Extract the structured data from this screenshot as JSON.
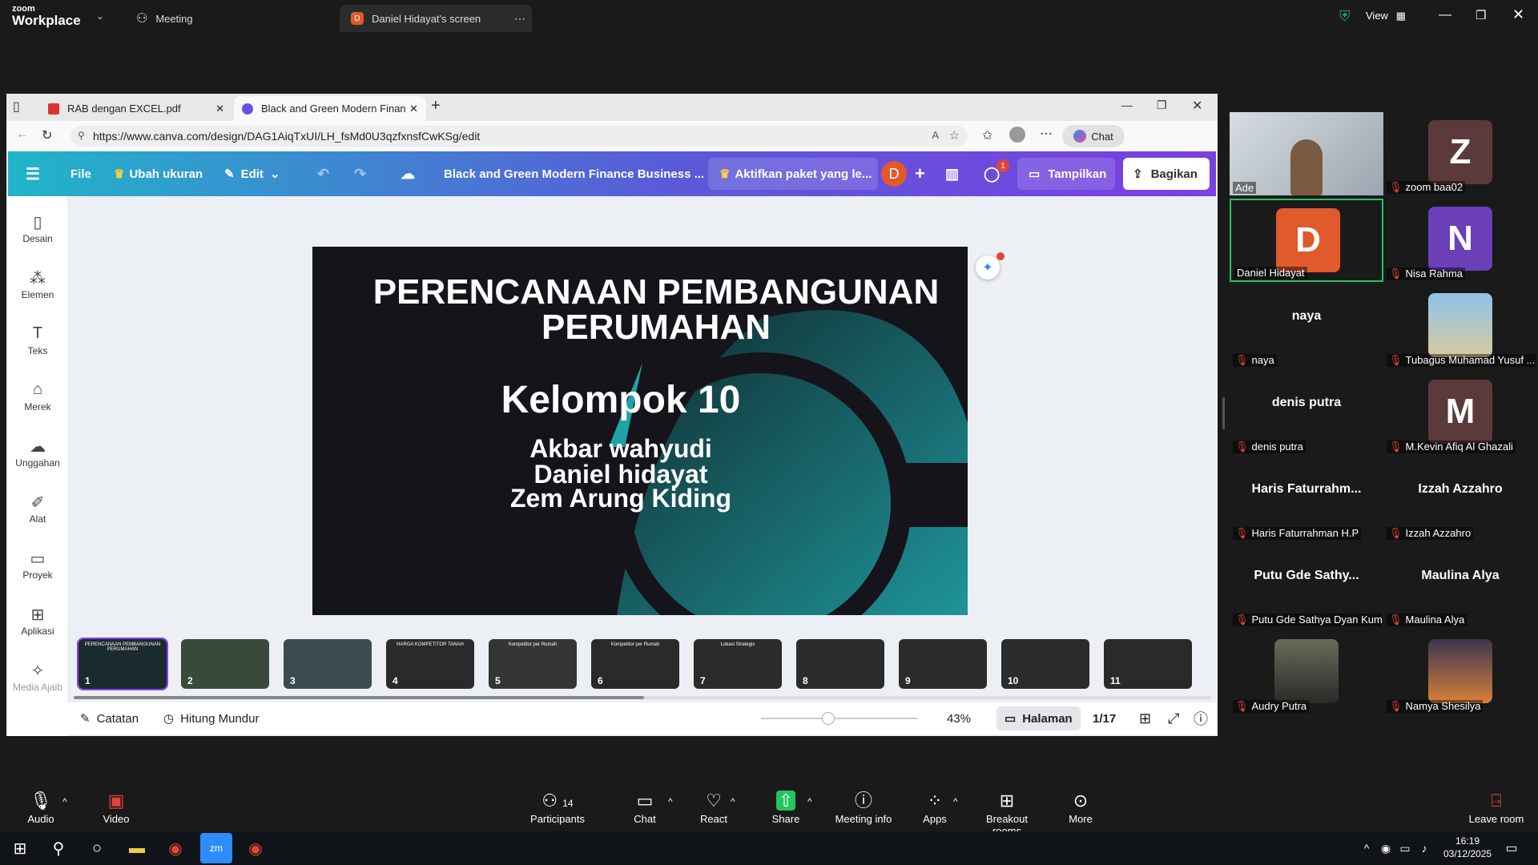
{
  "zoom_top": {
    "brand_line1": "zoom",
    "brand_line2": "Workplace",
    "meeting_label": "Meeting",
    "share_tab_badge": "D",
    "share_tab_label": "Daniel Hidayat's screen",
    "view_label": "View"
  },
  "browser": {
    "tab1_label": "RAB dengan EXCEL.pdf",
    "tab2_label": "Black and Green Modern Finance",
    "url": "https://www.canva.com/design/DAG1AiqTxUI/LH_fsMd0U3qzfxnsfCwKSg/edit",
    "chat_label": "Chat"
  },
  "canva": {
    "file_label": "File",
    "resize_label": "Ubah ukuran",
    "edit_label": "Edit",
    "doc_title": "Black and Green Modern Finance Business ...",
    "activate_label": "Aktifkan paket yang le...",
    "avatar_letter": "D",
    "comment_count": "1",
    "present_label": "Tampilkan",
    "share_label": "Bagikan",
    "sidebar": [
      "Desain",
      "Elemen",
      "Teks",
      "Merek",
      "Unggahan",
      "Alat",
      "Proyek",
      "Aplikasi",
      "Media Ajaib"
    ],
    "slide": {
      "title_line1": "PERENCANAAN PEMBANGUNAN",
      "title_line2": "PERUMAHAN",
      "group": "Kelompok 10",
      "member1": "Akbar wahyudi",
      "member2": "Daniel hidayat",
      "member3": "Zem Arung Kiding"
    },
    "thumbnails": [
      {
        "num": "1",
        "title": "PERENCANAAN PEMBANGUNAN PERUMAHAN"
      },
      {
        "num": "2",
        "title": ""
      },
      {
        "num": "3",
        "title": ""
      },
      {
        "num": "4",
        "title": "HARGA KOMPETITOR TANAH"
      },
      {
        "num": "5",
        "title": "Kompetitor per Rumah"
      },
      {
        "num": "6",
        "title": "Kompetitor per Rumah"
      },
      {
        "num": "7",
        "title": "Lokasi Strategis"
      },
      {
        "num": "8",
        "title": ""
      },
      {
        "num": "9",
        "title": ""
      },
      {
        "num": "10",
        "title": ""
      },
      {
        "num": "11",
        "title": ""
      }
    ],
    "footer": {
      "notes_label": "Catatan",
      "timer_label": "Hitung Mundur",
      "zoom_percent": "43%",
      "zoom_level": 0.43,
      "pages_label": "Halaman",
      "page_count": "1/17"
    }
  },
  "participants": [
    {
      "name": "Ade",
      "type": "video",
      "muted": false
    },
    {
      "name": "zoom baa02",
      "letter": "Z",
      "color": "#5a3a3a",
      "muted": true
    },
    {
      "name": "Daniel Hidayat",
      "letter": "D",
      "color": "#e05a2b",
      "muted": false,
      "active": true
    },
    {
      "name": "Nisa Rahma",
      "letter": "N",
      "color": "#6a3fb8",
      "muted": true
    },
    {
      "name": "naya",
      "big": "naya",
      "muted": true
    },
    {
      "name": "Tubagus Muhamad Yusuf ...",
      "type": "photo",
      "muted": true
    },
    {
      "name": "denis putra",
      "big": "denis putra",
      "muted": true
    },
    {
      "name": "M.Kevin Afiq Al Ghazali",
      "letter": "M",
      "color": "#5a3a3a",
      "muted": true
    },
    {
      "name": "Haris Faturrahman H.P",
      "big": "Haris  Faturrahm...",
      "muted": true
    },
    {
      "name": "Izzah Azzahro",
      "big": "Izzah Azzahro",
      "muted": true
    },
    {
      "name": "Putu Gde Sathya Dyan Kum...",
      "big": "Putu  Gde  Sathy...",
      "muted": true
    },
    {
      "name": "Maulina Alya",
      "big": "Maulina Alya",
      "muted": true
    },
    {
      "name": "Audry Putra",
      "type": "photo2",
      "muted": true
    },
    {
      "name": "Namya Shesilya",
      "type": "photo3",
      "muted": true
    }
  ],
  "zoom_bottom": {
    "audio": "Audio",
    "video": "Video",
    "participants": "Participants",
    "participants_count": "14",
    "chat": "Chat",
    "react": "React",
    "share": "Share",
    "meeting_info": "Meeting info",
    "apps": "Apps",
    "breakout": "Breakout rooms",
    "more": "More",
    "leave": "Leave room"
  },
  "taskbar": {
    "time": "16:19",
    "date": "03/12/2025"
  }
}
